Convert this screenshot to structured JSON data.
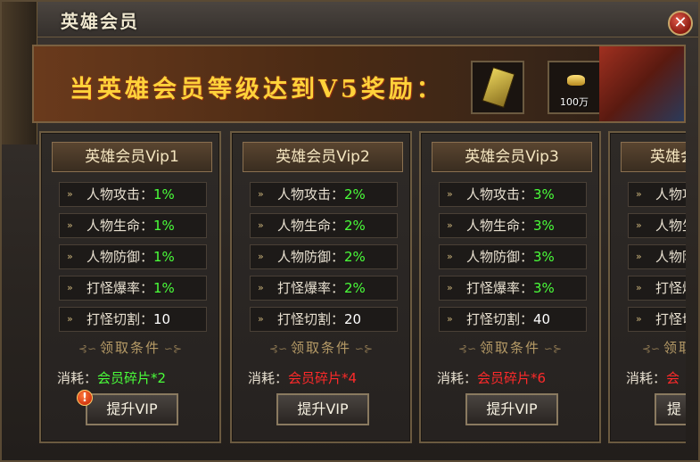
{
  "window": {
    "title": "英雄会员",
    "close_symbol": "✕"
  },
  "banner": {
    "text": "当英雄会员等级达到V5奖励：",
    "rewards": [
      {
        "icon": "gold-book-icon",
        "label": ""
      },
      {
        "icon": "gold-ingot-icon",
        "label": "100万"
      }
    ]
  },
  "cards": [
    {
      "title": "英雄会员Vip1",
      "stats": [
        {
          "label": "人物攻击：",
          "value": "1%"
        },
        {
          "label": "人物生命：",
          "value": "1%"
        },
        {
          "label": "人物防御：",
          "value": "1%"
        },
        {
          "label": "打怪爆率：",
          "value": "1%"
        },
        {
          "label": "打怪切割：",
          "value": "10"
        }
      ],
      "condition_label": "领取条件",
      "cost_label": "消耗：",
      "cost_item": "会员碎片*2",
      "button": "提升VIP"
    },
    {
      "title": "英雄会员Vip2",
      "stats": [
        {
          "label": "人物攻击：",
          "value": "2%"
        },
        {
          "label": "人物生命：",
          "value": "2%"
        },
        {
          "label": "人物防御：",
          "value": "2%"
        },
        {
          "label": "打怪爆率：",
          "value": "2%"
        },
        {
          "label": "打怪切割：",
          "value": "20"
        }
      ],
      "condition_label": "领取条件",
      "cost_label": "消耗：",
      "cost_item": "会员碎片*4",
      "button": "提升VIP"
    },
    {
      "title": "英雄会员Vip3",
      "stats": [
        {
          "label": "人物攻击：",
          "value": "3%"
        },
        {
          "label": "人物生命：",
          "value": "3%"
        },
        {
          "label": "人物防御：",
          "value": "3%"
        },
        {
          "label": "打怪爆率：",
          "value": "3%"
        },
        {
          "label": "打怪切割：",
          "value": "40"
        }
      ],
      "condition_label": "领取条件",
      "cost_label": "消耗：",
      "cost_item": "会员碎片*6",
      "button": "提升VIP"
    },
    {
      "title": "英雄会",
      "stats": [
        {
          "label": "人物攻",
          "value": ""
        },
        {
          "label": "人物生",
          "value": ""
        },
        {
          "label": "人物防",
          "value": ""
        },
        {
          "label": "打怪爆",
          "value": ""
        },
        {
          "label": "打怪切",
          "value": ""
        }
      ],
      "condition_label": "领取",
      "cost_label": "消耗：",
      "cost_item": "会",
      "button": "提"
    }
  ],
  "alert_symbol": "!",
  "colors": {
    "value_green": "#4aff3a",
    "cost_red": "#ff2a2a",
    "banner_gold": "#ffd23a"
  }
}
